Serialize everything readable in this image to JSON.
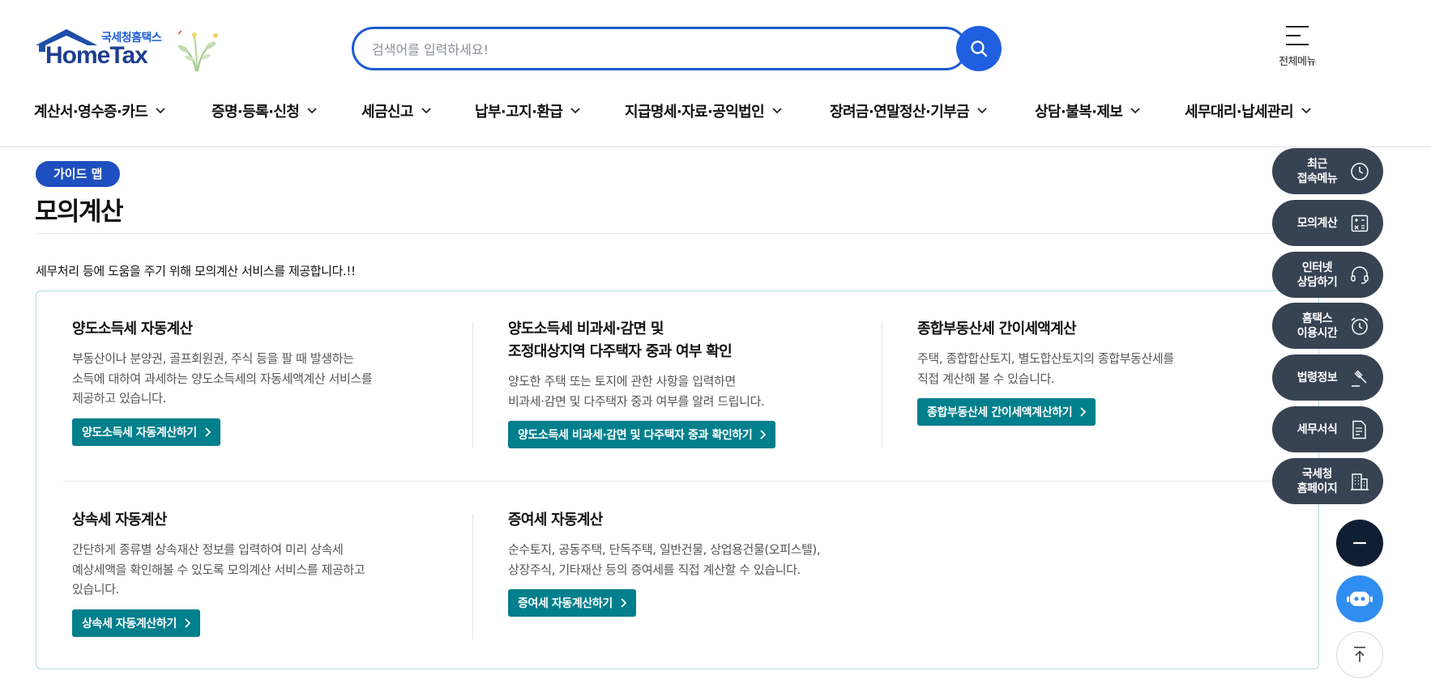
{
  "header": {
    "logo_sub": "국세청홈택스",
    "logo_main": "HomeTax",
    "search_placeholder": "검색어를 입력하세요!",
    "all_menu_label": "전체메뉴"
  },
  "gnb": [
    "계산서·영수증·카드",
    "증명·등록·신청",
    "세금신고",
    "납부·고지·환급",
    "지급명세·자료·공익법인",
    "장려금·연말정산·기부금",
    "상담·불복·제보",
    "세무대리·납세관리"
  ],
  "main": {
    "badge": "가이드 맵",
    "title": "모의계산",
    "description": "세무처리 등에 도움을 주기 위해 모의계산 서비스를 제공합니다.!!"
  },
  "items": [
    {
      "title": "양도소득세 자동계산",
      "desc_lines": [
        "부동산이나 분양권, 골프회원권, 주식 등을 팔 때 발생하는",
        "소득에 대하여 과세하는 양도소득세의 자동세액계산 서비스를",
        "제공하고 있습니다."
      ],
      "button": "양도소득세 자동계산하기"
    },
    {
      "title_lines": [
        "양도소득세 비과세·감면 및",
        "조정대상지역 다주택자 중과 여부 확인"
      ],
      "desc_lines": [
        "양도한 주택 또는 토지에 관한 사항을 입력하면",
        "비과세·감면 및 다주택자 중과 여부를 알려 드립니다."
      ],
      "button": "양도소득세 비과세·감면 및 다주택자 중과 확인하기"
    },
    {
      "title": "종합부동산세 간이세액계산",
      "desc_lines": [
        "주택, 종합합산토지, 별도합산토지의 종합부동산세를",
        "직접 계산해 볼 수 있습니다."
      ],
      "button": "종합부동산세 간이세액계산하기"
    },
    {
      "title": "상속세 자동계산",
      "desc_lines": [
        "간단하게 종류별 상속재산 정보를 입력하여 미리 상속세",
        "예상세액을 확인해볼 수 있도록 모의계산 서비스를 제공하고",
        "있습니다."
      ],
      "button": "상속세 자동계산하기"
    },
    {
      "title": "증여세 자동계산",
      "desc_lines": [
        "순수토지, 공동주택, 단독주택, 일반건물, 상업용건물(오피스텔),",
        "상장주식, 기타재산 등의 증여세를 직접 계산할 수 있습니다."
      ],
      "button": "증여세 자동계산하기"
    }
  ],
  "quick_menu": [
    {
      "label": "최근\n접속메뉴",
      "icon": "clock-icon"
    },
    {
      "label": "모의계산",
      "icon": "calculator-icon"
    },
    {
      "label": "인터넷\n상담하기",
      "icon": "headset-icon"
    },
    {
      "label": "홈택스\n이용시간",
      "icon": "alarm-clock-icon"
    },
    {
      "label": "법령정보",
      "icon": "gavel-icon"
    },
    {
      "label": "세무서식",
      "icon": "document-icon"
    },
    {
      "label": "국세청\n홈페이지",
      "icon": "building-icon"
    }
  ],
  "colors": {
    "primary_blue": "#1f5fe0",
    "badge_blue": "#1e4fc0",
    "teal_button": "#007f8c",
    "quick_menu_bg": "#374352",
    "minimize_bg": "#0f1e33",
    "chatbot_bg": "#2f8ef0"
  }
}
